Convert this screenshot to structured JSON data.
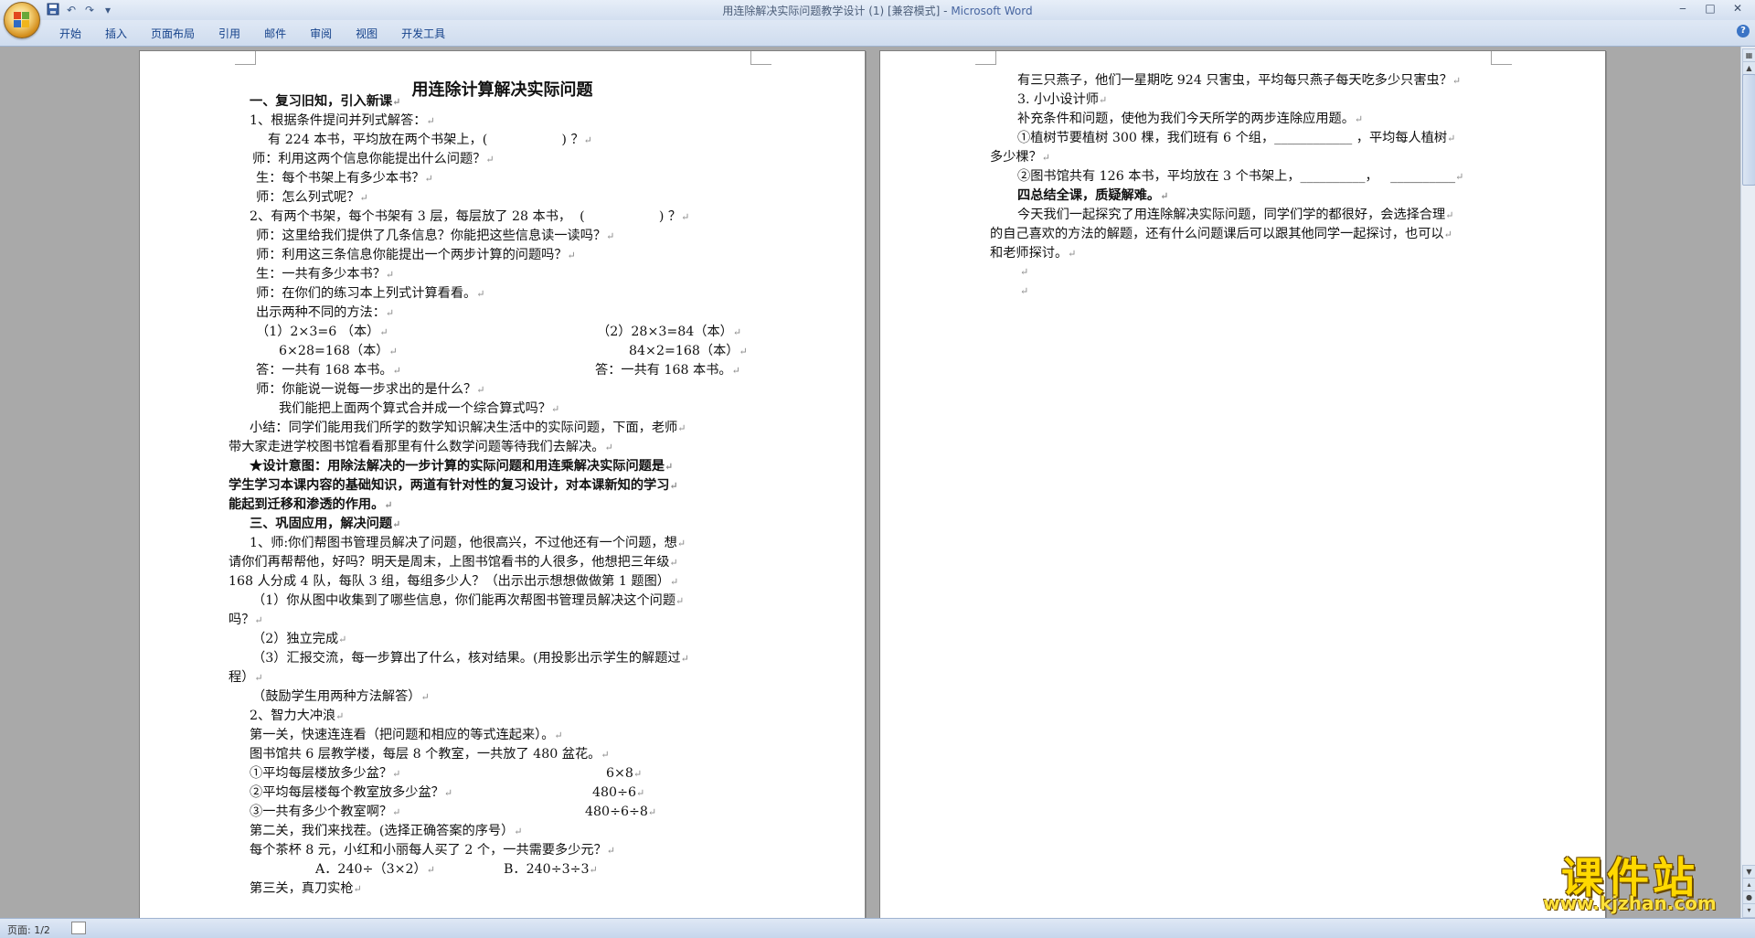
{
  "window": {
    "title": "用连除解决实际问题教学设计 (1) [兼容模式] - ",
    "app": "Microsoft Word",
    "minimize": "‒",
    "maximize": "□",
    "close": "✕"
  },
  "qat": {
    "save_icon": "save-icon",
    "undo": "↶",
    "redo": "↷",
    "customize": "▾"
  },
  "ribbon": {
    "tabs": [
      "开始",
      "插入",
      "页面布局",
      "引用",
      "邮件",
      "审阅",
      "视图",
      "开发工具"
    ],
    "help": "?"
  },
  "page1": {
    "title": "用连除计算解决实际问题",
    "lines": [
      "一、复习旧知，引入新课",
      "1、根据条件提问并列式解答：",
      "有 224 本书，平均放在两个书架上，(                  ) ？",
      "师：利用这两个信息你能提出什么问题？",
      "生：每个书架上有多少本书？",
      "师：怎么列式呢？",
      "2、有两个书架，每个书架有 3 层，每层放了 28 本书，  (                  ) ？",
      "师：这里给我们提供了几条信息？你能把这些信息读一读吗？",
      "师：利用这三条信息你能提出一个两步计算的问题吗？",
      "生：一共有多少本书？",
      "师：在你们的练习本上列式计算看看。",
      "出示两种不同的方法：",
      "（1）2×3=6 （本）",
      "（2）28×3=84（本）",
      "6×28=168（本）",
      "84×2=168（本）",
      "答：一共有 168 本书。",
      "答：一共有 168 本书。",
      "师：你能说一说每一步求出的是什么？",
      "我们能把上面两个算式合并成一个综合算式吗？",
      "小结：同学们能用我们所学的数学知识解决生活中的实际问题，下面，老师",
      "带大家走进学校图书馆看看那里有什么数学问题等待我们去解决。",
      "★设计意图：用除法解决的一步计算的实际问题和用连乘解决实际问题是",
      "学生学习本课内容的基础知识，两道有针对性的复习设计，对本课新知的学习",
      "能起到迁移和渗透的作用。",
      "三、巩固应用，解决问题",
      "1、师:你们帮图书管理员解决了问题，他很高兴，不过他还有一个问题，想",
      "请你们再帮帮他，好吗？明天是周末，上图书馆看书的人很多，他想把三年级",
      "168 人分成 4 队，每队 3 组，每组多少人？（出示出示想想做做第 1 题图）",
      "（1）你从图中收集到了哪些信息，你们能再次帮图书管理员解决这个问题",
      "吗？",
      "（2）独立完成",
      "（3）汇报交流，每一步算出了什么，核对结果。(用投影出示学生的解题过",
      "程）",
      "（鼓励学生用两种方法解答）",
      "2、智力大冲浪",
      "第一关，快速连连看（把问题和相应的等式连起来）。",
      "图书馆共 6 层教学楼，每层 8 个教室，一共放了 480 盆花。",
      "①平均每层楼放多少盆？",
      "6×8",
      "②平均每层楼每个教室放多少盆？",
      "480÷6",
      "③一共有多少个教室啊？",
      "480÷6÷8",
      "第二关，我们来找茬。(选择正确答案的序号）",
      "每个茶杯 8 元，小红和小丽每人买了 2 个，一共需要多少元？",
      "A．240÷（3×2）",
      "B．240÷3÷3",
      "第三关，真刀实枪"
    ]
  },
  "page2": {
    "lines": [
      "有三只燕子，他们一星期吃 924 只害虫，平均每只燕子每天吃多少只害虫？",
      "3. 小小设计师",
      "补充条件和问题，使他为我们今天所学的两步连除应用题。",
      "①植树节要植树 300 棵，我们班有 6 个组，____________ ，平均每人植树",
      "多少棵？",
      "②图书馆共有 126 本书，平均放在 3 个书架上，__________，   __________",
      "四总结全课，质疑解难。",
      "今天我们一起探究了用连除解决实际问题，同学们学的都很好，会选择合理",
      "的自己喜欢的方法的解题，还有什么问题课后可以跟其他同学一起探讨，也可以",
      "和老师探讨。"
    ],
    "pilcrow": "↵"
  },
  "status": {
    "page": "页面: 1/2"
  },
  "watermark": {
    "brand": "课件站",
    "url": "www.kjzhan.com"
  }
}
